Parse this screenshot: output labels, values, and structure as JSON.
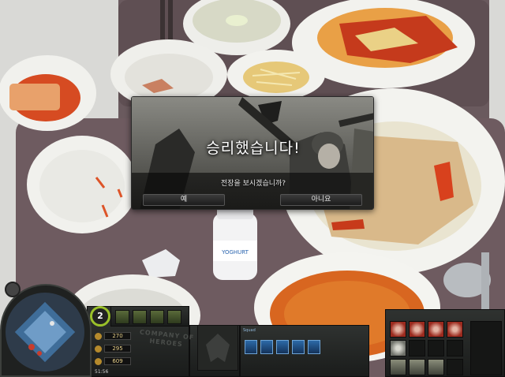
{
  "dialog": {
    "title": "승리했습니다!",
    "message": "전장을 보시겠습니까?",
    "yes_label": "예",
    "no_label": "아니요"
  },
  "hud": {
    "unit_count": "2",
    "resources": [
      {
        "name": "manpower",
        "value": "270"
      },
      {
        "name": "munitions",
        "value": "295"
      },
      {
        "name": "fuel",
        "value": "609"
      }
    ],
    "timer": "51:56",
    "logo_text": "COMPANY OF HEROES",
    "squad_label": "Squad"
  },
  "bottle_label": "YOGHURT",
  "colors": {
    "hud_accent": "#9ac02a",
    "squad_blue": "#2c6aa8",
    "ability_red": "#9b2a1e"
  }
}
